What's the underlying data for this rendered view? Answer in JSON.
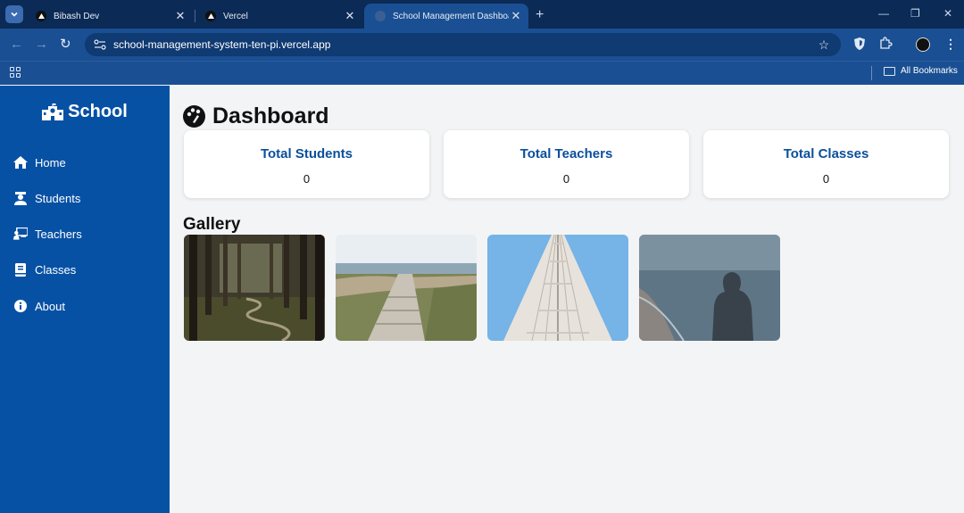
{
  "browser": {
    "tabs": [
      {
        "title": "Bibash Dev",
        "active": false
      },
      {
        "title": "Vercel",
        "active": false
      },
      {
        "title": "School Management Dashboard",
        "active": true
      }
    ],
    "url": "school-management-system-ten-pi.vercel.app",
    "bookmarks_label": "All Bookmarks"
  },
  "sidebar": {
    "brand": "School",
    "items": [
      {
        "label": "Home",
        "icon": "home-icon"
      },
      {
        "label": "Students",
        "icon": "student-icon"
      },
      {
        "label": "Teachers",
        "icon": "teacher-icon"
      },
      {
        "label": "Classes",
        "icon": "book-icon"
      },
      {
        "label": "About",
        "icon": "info-icon"
      }
    ]
  },
  "main": {
    "title": "Dashboard",
    "cards": [
      {
        "title": "Total Students",
        "value": "0"
      },
      {
        "title": "Total Teachers",
        "value": "0"
      },
      {
        "title": "Total Classes",
        "value": "0"
      }
    ],
    "gallery_title": "Gallery",
    "gallery": [
      "forest-path-photo",
      "beach-boardwalk-photo",
      "skyscraper-photo",
      "hooded-person-shore-photo"
    ]
  },
  "colors": {
    "sidebar": "#0751a4",
    "card_title": "#0a4f9c",
    "chrome_dark": "#0b2a55",
    "chrome": "#1a4f93"
  }
}
